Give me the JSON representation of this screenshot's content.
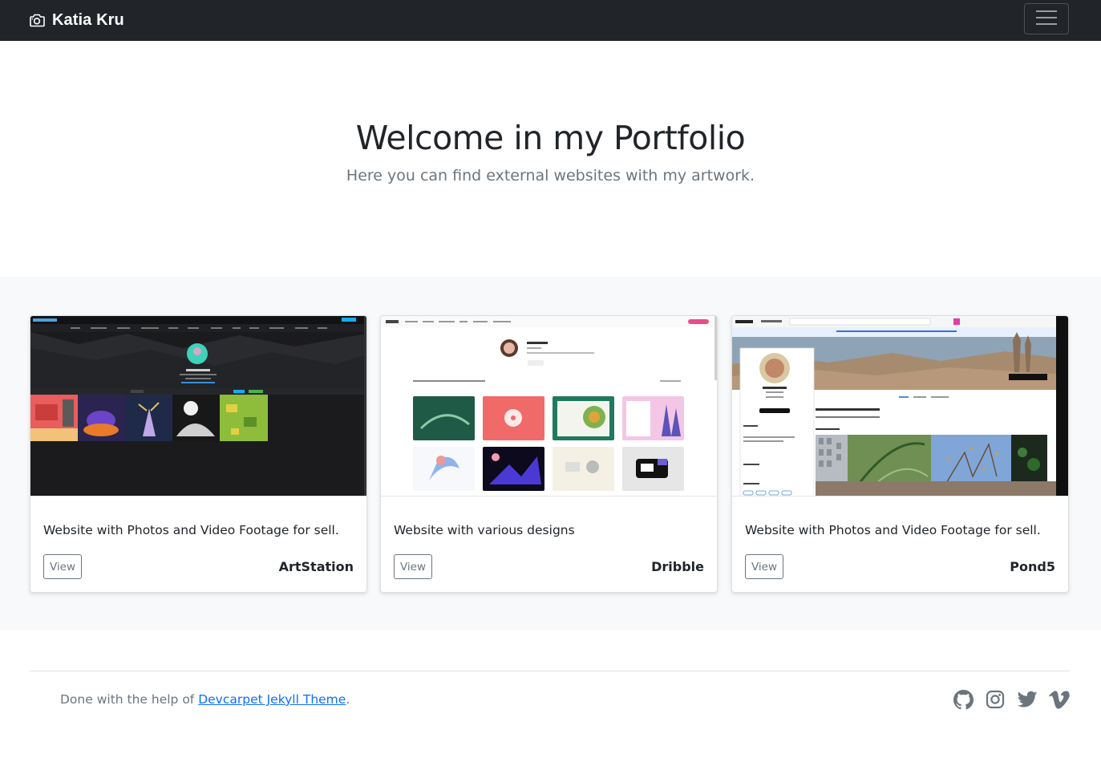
{
  "navbar": {
    "brand": "Katia Kru",
    "brand_icon": "camera-icon",
    "toggler_icon": "hamburger-icon"
  },
  "hero": {
    "title": "Welcome in my Portfolio",
    "subtitle": "Here you can find external websites with my artwork."
  },
  "cards": [
    {
      "description": "Website with Photos and Video Footage for sell.",
      "button": "View",
      "site": "ArtStation",
      "thumb": {
        "profile_name": "Katia Kru"
      }
    },
    {
      "description": "Website with various designs",
      "button": "View",
      "site": "Dribble",
      "thumb": {
        "profile_name": "Katia K"
      }
    },
    {
      "description": "Website with Photos and Video Footage for sell.",
      "button": "View",
      "site": "Pond5",
      "thumb": {
        "profile_name": "Katia Kru",
        "logo": "POND5"
      }
    }
  ],
  "footer": {
    "text_prefix": "Done with the help of ",
    "link": "Devcarpet Jekyll Theme",
    "text_suffix": ".",
    "social_icons": [
      "github-icon",
      "instagram-icon",
      "twitter-icon",
      "vimeo-icon"
    ]
  },
  "colors": {
    "navbar_bg": "#212529",
    "album_bg": "#f8f9fa",
    "link": "#0d6efd",
    "muted": "#6c757d"
  }
}
